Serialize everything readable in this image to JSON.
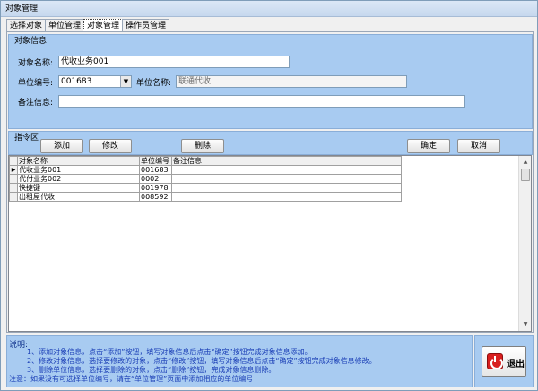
{
  "window": {
    "title": "对象管理"
  },
  "tabs": [
    "选择对象",
    "单位管理",
    "对象管理",
    "操作员管理"
  ],
  "object_info": {
    "group_title": "对象信息:",
    "name_label": "对象名称:",
    "name_value": "代收业务001",
    "unit_code_label": "单位编号:",
    "unit_code_value": "001683",
    "unit_name_label": "单位名称:",
    "unit_name_value": "联通代收",
    "remark_label": "备注信息:",
    "remark_value": ""
  },
  "commands": {
    "group_title": "指令区",
    "add": "添加",
    "edit": "修改",
    "delete": "删除",
    "confirm": "确定",
    "cancel": "取消"
  },
  "grid": {
    "columns": [
      "对象名称",
      "单位编号",
      "备注信息"
    ],
    "rows": [
      [
        "代收业务001",
        "001683",
        ""
      ],
      [
        "代付业务002",
        "0002",
        ""
      ],
      [
        "快捷键",
        "001978",
        ""
      ],
      [
        "出租屋代收",
        "008592",
        ""
      ]
    ],
    "selected_marker": "▶"
  },
  "help": {
    "title": "说明:",
    "lines": [
      "1、添加对象信息，点击“添加”按钮，填写对象信息后点击“确定”按钮完成对象信息添加。",
      "2、修改对象信息，选择要修改的对象，点击“修改”按钮，填写对象信息后点击“确定”按钮完成对象信息修改。",
      "3、删除单位信息，选择要删除的对象，点击“删除”按钮，完成对象信息删除。",
      "注意：如果没有可选择单位编号，请在“单位管理”页面中添加相应的单位编号"
    ]
  },
  "exit": {
    "label": "退出"
  },
  "icons": {
    "dropdown": "chevron-down-icon",
    "exit": "power-icon",
    "scroll_up": "arrow-up-icon",
    "scroll_down": "arrow-down-icon"
  }
}
